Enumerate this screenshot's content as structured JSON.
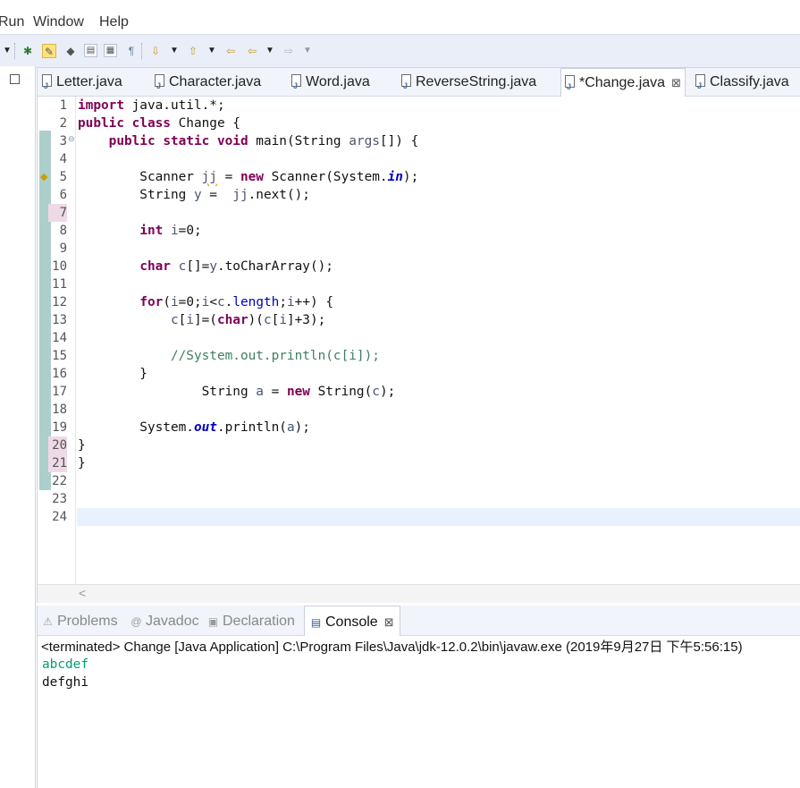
{
  "menu": {
    "run": "Run",
    "window": "Window",
    "help": "Help"
  },
  "toolbar": {
    "icons": [
      "dropdown-arrow",
      "debug-icon",
      "highlight-icon",
      "annotation-icon",
      "open-type-icon",
      "task-icon",
      "show-whitespace-icon",
      "next-annotation-icon",
      "prev-annotation-icon",
      "last-edit-icon",
      "back-icon",
      "forward-icon"
    ]
  },
  "tabs": [
    {
      "label": "Letter.java"
    },
    {
      "label": "Character.java"
    },
    {
      "label": "Word.java"
    },
    {
      "label": "ReverseString.java"
    },
    {
      "label": "*Change.java",
      "active": true,
      "close": "⊠"
    },
    {
      "label": "Classify.java"
    }
  ],
  "editor": {
    "line_numbers": [
      "1",
      "2",
      "3",
      "4",
      "5",
      "6",
      "7",
      "8",
      "9",
      "10",
      "11",
      "12",
      "13",
      "14",
      "15",
      "16",
      "17",
      "18",
      "19",
      "20",
      "21",
      "22",
      "23",
      "24"
    ],
    "code": {
      "l1_kw": "import",
      "l1_rest": " java.util.*;",
      "l2_kw1": "public",
      "l2_kw2": "class",
      "l2_rest": " Change {",
      "l3_indent": "    ",
      "l3_kw1": "public",
      "l3_kw2": "static",
      "l3_kw3": "void",
      "l3_a": " main(String ",
      "l3_var": "args",
      "l3_b": "[]) {",
      "l5_a": "        Scanner ",
      "l5_var": "jj",
      "l5_b": " = ",
      "l5_kw": "new",
      "l5_c": " Scanner(System.",
      "l5_fld": "in",
      "l5_d": ");",
      "l6_a": "        String ",
      "l6_var": "y",
      "l6_b": " =  ",
      "l6_var2": "jj",
      "l6_c": ".next();",
      "l8_indent": "        ",
      "l8_kw": "int",
      "l8_a": " ",
      "l8_var": "i",
      "l8_b": "=0;",
      "l10_indent": "        ",
      "l10_kw": "char",
      "l10_a": " ",
      "l10_var": "c",
      "l10_b": "[]=",
      "l10_var2": "y",
      "l10_c": ".toCharArray();",
      "l12_indent": "        ",
      "l12_kw": "for",
      "l12_a": "(",
      "l12_v1": "i",
      "l12_b": "=0;",
      "l12_v2": "i",
      "l12_c": "<",
      "l12_v3": "c",
      "l12_d": ".",
      "l12_fld": "length",
      "l12_e": ";",
      "l12_v4": "i",
      "l12_f": "++) {",
      "l13_indent": "            ",
      "l13_v1": "c",
      "l13_a": "[",
      "l13_v2": "i",
      "l13_b": "]=(",
      "l13_kw": "char",
      "l13_c": ")(",
      "l13_v3": "c",
      "l13_d": "[",
      "l13_v4": "i",
      "l13_e": "]+3);",
      "l15_indent": "            ",
      "l15_cm": "//System.out.println(c[i]);",
      "l16": "        }",
      "l17_a": "                String ",
      "l17_var": "a",
      "l17_b": " = ",
      "l17_kw": "new",
      "l17_c": " String(",
      "l17_var2": "c",
      "l17_d": ");",
      "l19_a": "        System.",
      "l19_fld": "out",
      "l19_b": ".println(",
      "l19_var": "a",
      "l19_c": ");",
      "l20": "}",
      "l21": "}"
    },
    "scroll_left": "<"
  },
  "console": {
    "tabs": [
      {
        "label": "Problems",
        "icon": "problems-icon"
      },
      {
        "label": "Javadoc",
        "icon": "at-icon"
      },
      {
        "label": "Declaration",
        "icon": "declaration-icon"
      },
      {
        "label": "Console",
        "icon": "console-icon",
        "active": true,
        "close": "⊠"
      }
    ],
    "status": "<terminated> Change [Java Application] C:\\Program Files\\Java\\jdk-12.0.2\\bin\\javaw.exe (2019年9月27日 下午5:56:15)",
    "input_line": "abcdef",
    "output_line": "defghi",
    "input_color": "#00a070",
    "output_color": "#111111"
  }
}
